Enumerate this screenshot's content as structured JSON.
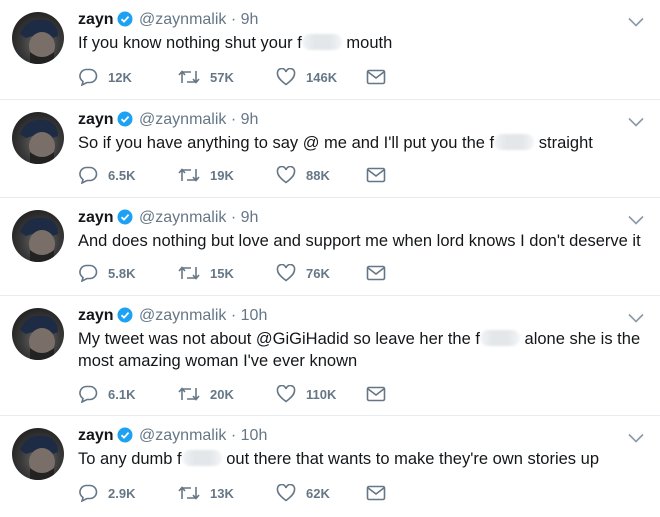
{
  "colors": {
    "verified": "#1da1f2",
    "muted": "#657786",
    "text": "#14171a",
    "divider": "#e6ecf0"
  },
  "icons": {
    "reply": "speech-bubble-icon",
    "retweet": "retweet-icon",
    "like": "heart-icon",
    "dm": "envelope-icon",
    "menu": "chevron-down-icon",
    "verified": "verified-badge-icon"
  },
  "tweets": [
    {
      "name": "zayn",
      "handle": "@zaynmalik",
      "sep": "·",
      "time": "9h",
      "text_a": "If you know nothing shut your f",
      "text_b": " mouth",
      "replies": "12K",
      "retweets": "57K",
      "likes": "146K"
    },
    {
      "name": "zayn",
      "handle": "@zaynmalik",
      "sep": "·",
      "time": "9h",
      "text_a": "So if you have anything to say @ me and I'll put you the f",
      "text_b": " straight",
      "replies": "6.5K",
      "retweets": "19K",
      "likes": "88K"
    },
    {
      "name": "zayn",
      "handle": "@zaynmalik",
      "sep": "·",
      "time": "9h",
      "text_a": "And does nothing but love and support me when lord knows I don't deserve it",
      "text_b": "",
      "replies": "5.8K",
      "retweets": "15K",
      "likes": "76K"
    },
    {
      "name": "zayn",
      "handle": "@zaynmalik",
      "sep": "·",
      "time": "10h",
      "text_a": "My tweet was not about @GiGiHadid so leave her the f",
      "text_b": " alone she is the most amazing woman I've ever known",
      "replies": "6.1K",
      "retweets": "20K",
      "likes": "110K"
    },
    {
      "name": "zayn",
      "handle": "@zaynmalik",
      "sep": "·",
      "time": "10h",
      "text_a": "To any dumb f",
      "text_b": " out there that wants to make they're own stories up",
      "replies": "2.9K",
      "retweets": "13K",
      "likes": "62K"
    }
  ]
}
